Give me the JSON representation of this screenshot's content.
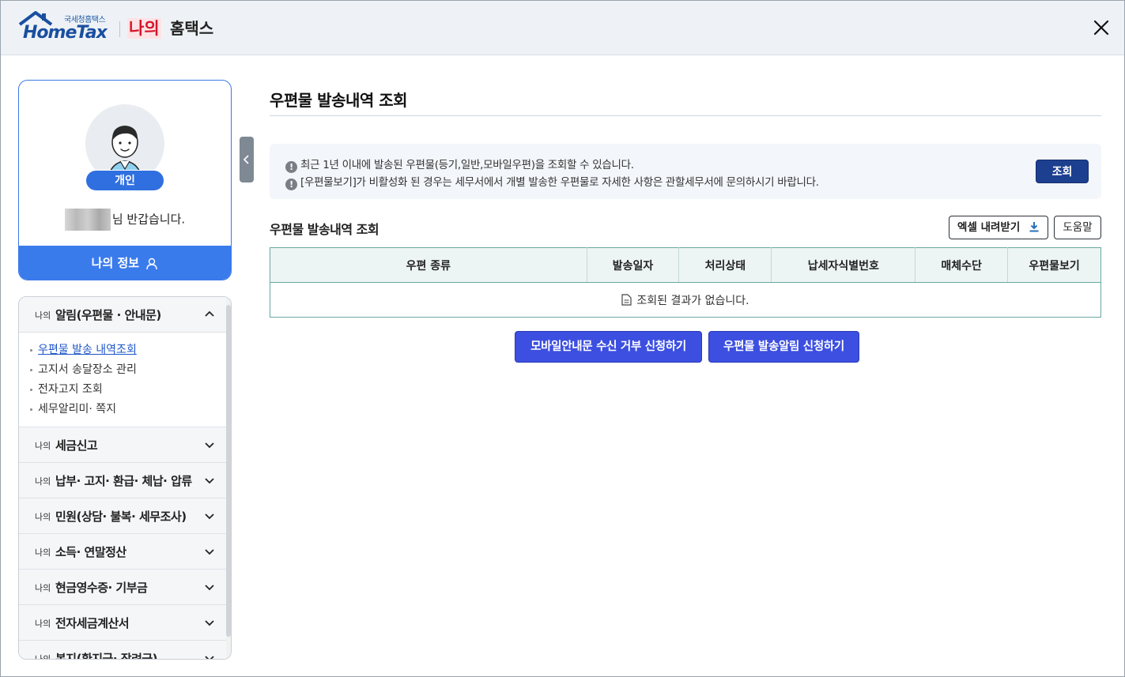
{
  "header": {
    "logo_sub": "국세청홈택스",
    "logo_main": "HomeTax",
    "my_label": "나의",
    "service_label": "홈택스"
  },
  "profile": {
    "badge": "개인",
    "greeting_suffix": "님 반갑습니다.",
    "myinfo_label": "나의 정보"
  },
  "menu": {
    "prefix": "나의",
    "sections": [
      {
        "title": "알림(우편물 · 안내문)",
        "open": true
      },
      {
        "title": "세금신고",
        "open": false
      },
      {
        "title": "납부· 고지· 환급· 체납· 압류",
        "open": false
      },
      {
        "title": "민원(상담· 불복· 세무조사)",
        "open": false
      },
      {
        "title": "소득· 연말정산",
        "open": false
      },
      {
        "title": "현금영수증· 기부금",
        "open": false
      },
      {
        "title": "전자세금계산서",
        "open": false
      },
      {
        "title": "복지(환지급· 장려금)",
        "open": false
      }
    ],
    "submenu": [
      "우편물 발송 내역조회",
      "고지서 송달장소 관리",
      "전자고지 조회",
      "세무알리미· 쪽지"
    ]
  },
  "main": {
    "page_title": "우편물 발송내역 조회",
    "notices": [
      "최근 1년 이내에 발송된 우편물(등기,일반,모바일우편)을 조회할 수 있습니다.",
      "[우편물보기]가 비활성화 된 경우는 세무서에서 개별 발송한 우편물로 자세한 사항은 관할세무서에 문의하시기 바랍니다."
    ],
    "search_label": "조회",
    "section_title": "우편물 발송내역 조회",
    "excel_label": "엑셀 내려받기",
    "help_label": "도움말",
    "table_headers": [
      "우편 종류",
      "발송일자",
      "처리상태",
      "납세자식별번호",
      "매체수단",
      "우편물보기"
    ],
    "empty_message": "조회된 결과가 없습니다.",
    "mobile_refuse_label": "모바일안내문 수신 거부 신청하기",
    "mail_alert_label": "우편물 발송알림 신청하기"
  },
  "colors": {
    "accent": "#3a7bec",
    "dark_button": "#1d3f8f",
    "action_button": "#3c4fe0",
    "brand_red": "#d6162a"
  }
}
